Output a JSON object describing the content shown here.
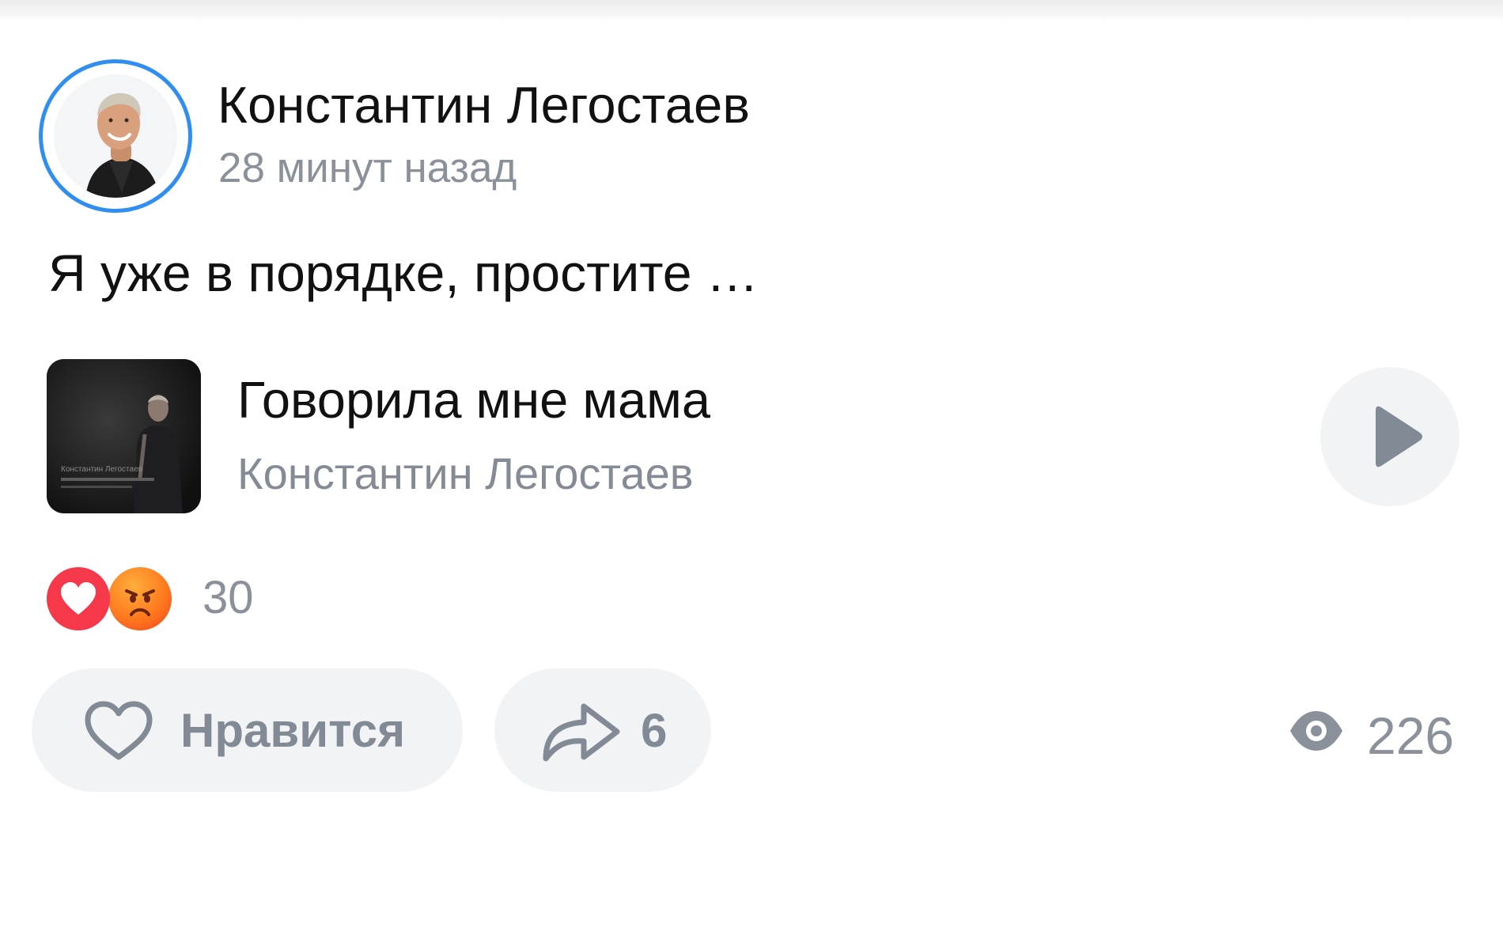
{
  "post": {
    "author_name": "Константин Легостаев",
    "time": "28 минут назад",
    "text": "Я уже в порядке, простите …"
  },
  "attachment": {
    "track_title": "Говорила мне мама",
    "track_artist": "Константин Легостаев",
    "cover_caption": "Константин Легостаев"
  },
  "reactions": {
    "icons": [
      "heart-icon",
      "angry-face-icon"
    ],
    "count": "30"
  },
  "actions": {
    "like_label": "Нравится",
    "share_count": "6",
    "views_count": "226"
  },
  "colors": {
    "accent_ring": "#2f8ef0",
    "secondary_text": "#8a919a",
    "button_bg": "#f2f3f5",
    "heart_reaction": "#f5384a",
    "angry_reaction": "#ff7a1f"
  }
}
